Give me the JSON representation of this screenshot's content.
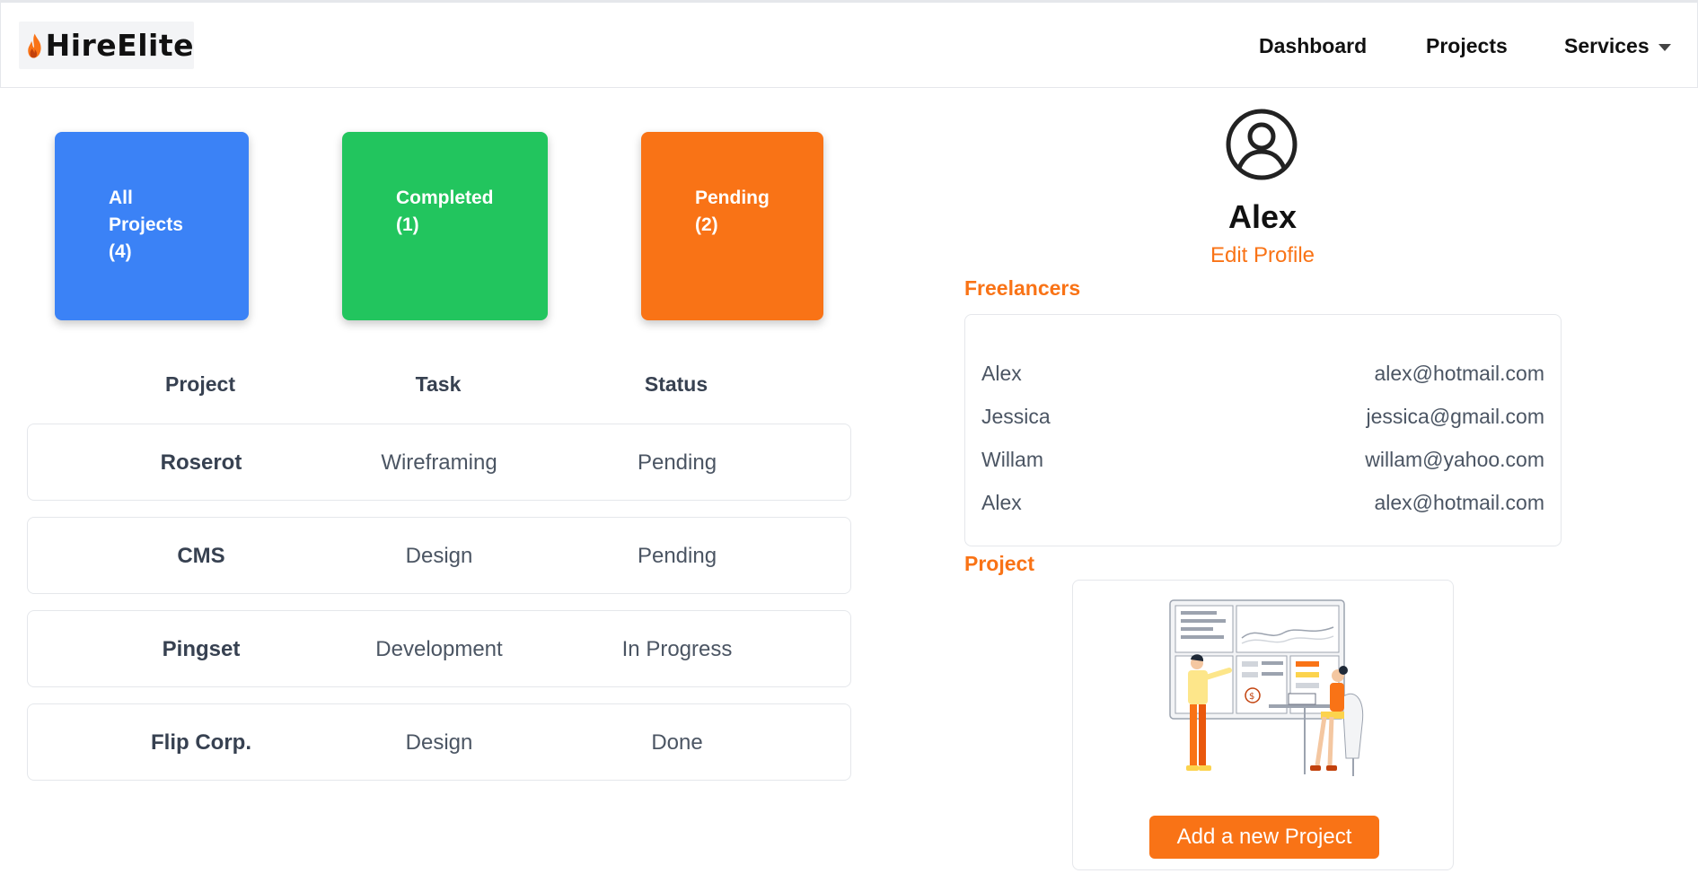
{
  "brand": {
    "name": "HireElite",
    "accent": "#f97316"
  },
  "nav": {
    "dashboard": "Dashboard",
    "projects": "Projects",
    "services": "Services"
  },
  "stats": {
    "all": {
      "line1": "All",
      "line2": "Projects",
      "line3": "(4)",
      "color": "#3b82f6"
    },
    "completed": {
      "line1": "Completed",
      "line2": "(1)",
      "color": "#22c55e"
    },
    "pending": {
      "line1": "Pending",
      "line2": "(2)",
      "color": "#f97316"
    }
  },
  "table": {
    "headers": [
      "Project",
      "Task",
      "Status"
    ],
    "rows": [
      [
        "Roserot",
        "Wireframing",
        "Pending"
      ],
      [
        "CMS",
        "Design",
        "Pending"
      ],
      [
        "Pingset",
        "Development",
        "In Progress"
      ],
      [
        "Flip Corp.",
        "Design",
        "Done"
      ]
    ]
  },
  "profile": {
    "name": "Alex",
    "edit_label": "Edit Profile",
    "avatar_icon": "user-circle-icon"
  },
  "freelancers": {
    "title": "Freelancers",
    "items": [
      {
        "name": "Alex",
        "email": "alex@hotmail.com"
      },
      {
        "name": "Jessica",
        "email": "jessica@gmail.com"
      },
      {
        "name": "Willam",
        "email": "willam@yahoo.com"
      },
      {
        "name": "Alex",
        "email": "alex@hotmail.com"
      }
    ]
  },
  "project_section": {
    "title": "Project",
    "add_label": "Add a new Project",
    "illustration": "dashboard-meeting-illustration"
  }
}
